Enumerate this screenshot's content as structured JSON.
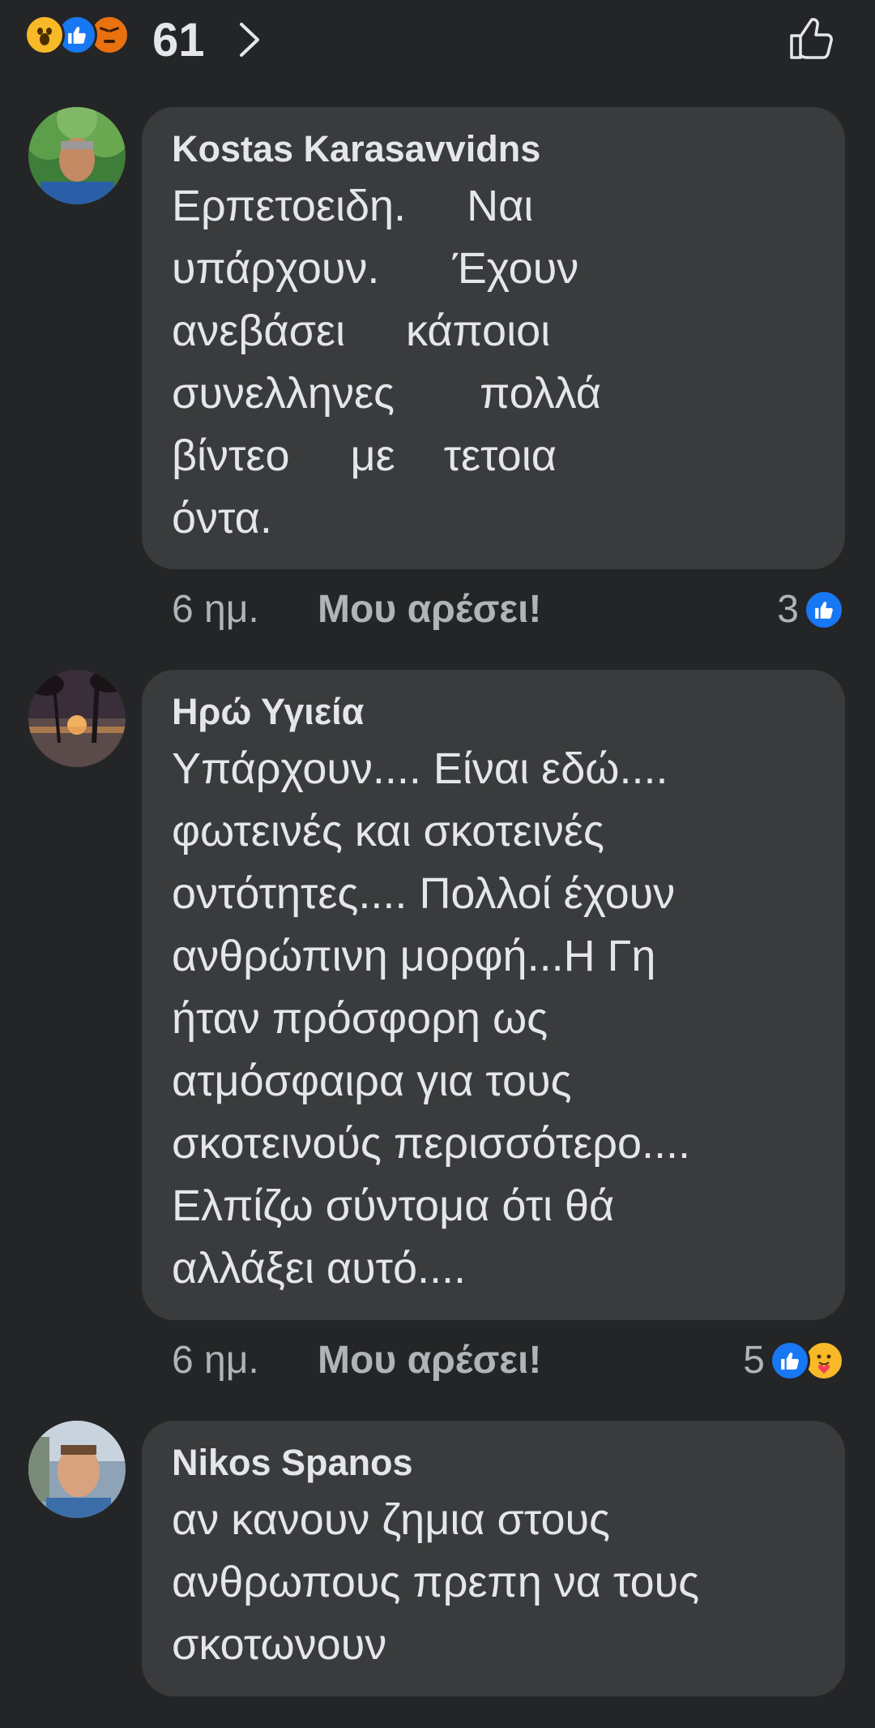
{
  "header": {
    "reaction_icons": [
      "wow-icon",
      "like-icon",
      "angry-icon"
    ],
    "reaction_total": "61",
    "chevron_icon": "chevron-right-icon",
    "like_icon": "thumbs-up-outline-icon"
  },
  "colors": {
    "background": "#242526",
    "bubble": "#3a3b3c",
    "text_primary": "#e4e6eb",
    "text_secondary": "#b0b3b8",
    "like_blue": "#1877f2",
    "reaction_yellow": "#f7b928",
    "angry_orange": "#e9710f"
  },
  "comments": [
    {
      "author": "Kostas Karasavvidns",
      "text": "Ερπετοειδη.     Ναι\nυπάρχουν.      Έχουν\nανεβάσει     κάποιοι\nσυνελληνες       πολλά\nβίντεο     με    τετοια\nόντα.",
      "time": "6 ημ.",
      "like_label": "Μου αρέσει!",
      "reaction_count": "3",
      "reactions": [
        "like-icon"
      ]
    },
    {
      "author": "Ηρώ Υγιεία",
      "text": "Υπάρχουν.... Είναι εδώ....\nφωτεινές και σκοτεινές\nοντότητες.... Πολλοί έχουν\nανθρώπινη μορφή...Η Γη\nήταν πρόσφορη ως\nατμόσφαιρα για τους\nσκοτεινούς περισσότερο....\nΕλπίζω σύντομα ότι θά\nαλλάξει αυτό....",
      "time": "6 ημ.",
      "like_label": "Μου αρέσει!",
      "reaction_count": "5",
      "reactions": [
        "like-icon",
        "care-icon"
      ]
    },
    {
      "author": "Nikos Spanos",
      "text": "αν κανουν ζημια στους\nανθρωπους πρεπη να τους\nσκοτωνουν"
    }
  ]
}
